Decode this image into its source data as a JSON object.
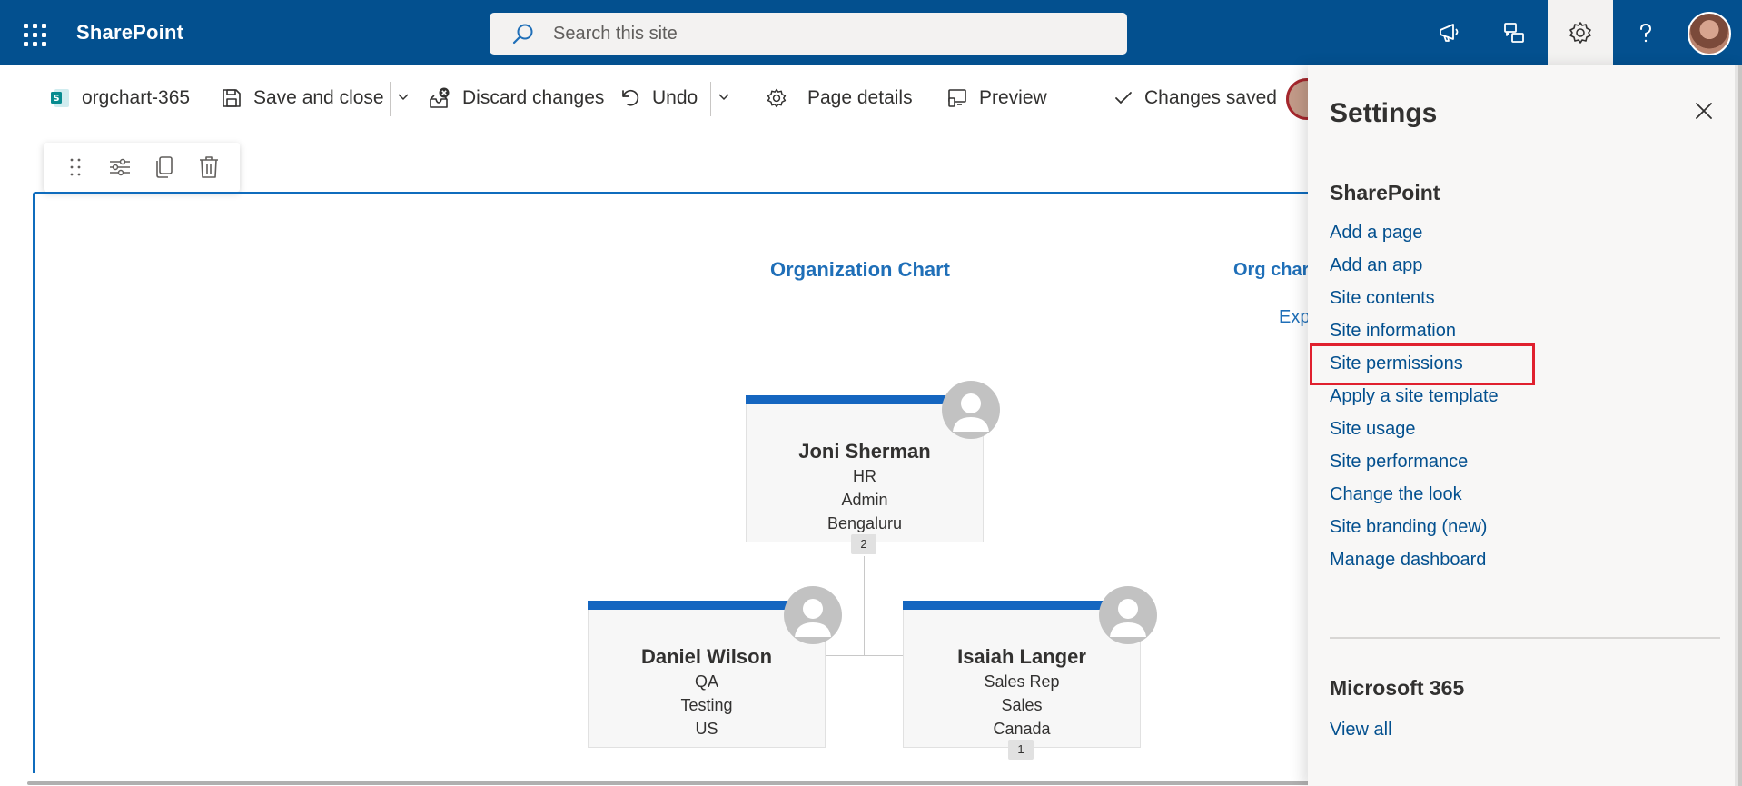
{
  "suitebar": {
    "brand": "SharePoint",
    "search_placeholder": "Search this site"
  },
  "commandbar": {
    "page_name": "orgchart-365",
    "save_close": "Save and close",
    "discard": "Discard changes",
    "undo": "Undo",
    "page_details": "Page details",
    "preview": "Preview",
    "status": "Changes saved"
  },
  "canvas": {
    "title": "Organization Chart",
    "title2": "Org char",
    "exp": "Exp"
  },
  "orgchart": {
    "root": {
      "name": "Joni Sherman",
      "line1": "HR",
      "line2": "Admin",
      "line3": "Bengaluru",
      "badge": "2"
    },
    "children": [
      {
        "name": "Daniel Wilson",
        "line1": "QA",
        "line2": "Testing",
        "line3": "US"
      },
      {
        "name": "Isaiah Langer",
        "line1": "Sales Rep",
        "line2": "Sales",
        "line3": "Canada",
        "badge": "1"
      }
    ]
  },
  "settings": {
    "title": "Settings",
    "section_sharepoint": "SharePoint",
    "links": [
      "Add a page",
      "Add an app",
      "Site contents",
      "Site information",
      "Site permissions",
      "Apply a site template",
      "Site usage",
      "Site performance",
      "Change the look",
      "Site branding (new)",
      "Manage dashboard"
    ],
    "section_m365": "Microsoft 365",
    "view_all": "View all"
  },
  "colors": {
    "suitebar": "#03508f",
    "accent": "#1566c0",
    "link": "#03508f",
    "highlight": "#e0202e"
  }
}
